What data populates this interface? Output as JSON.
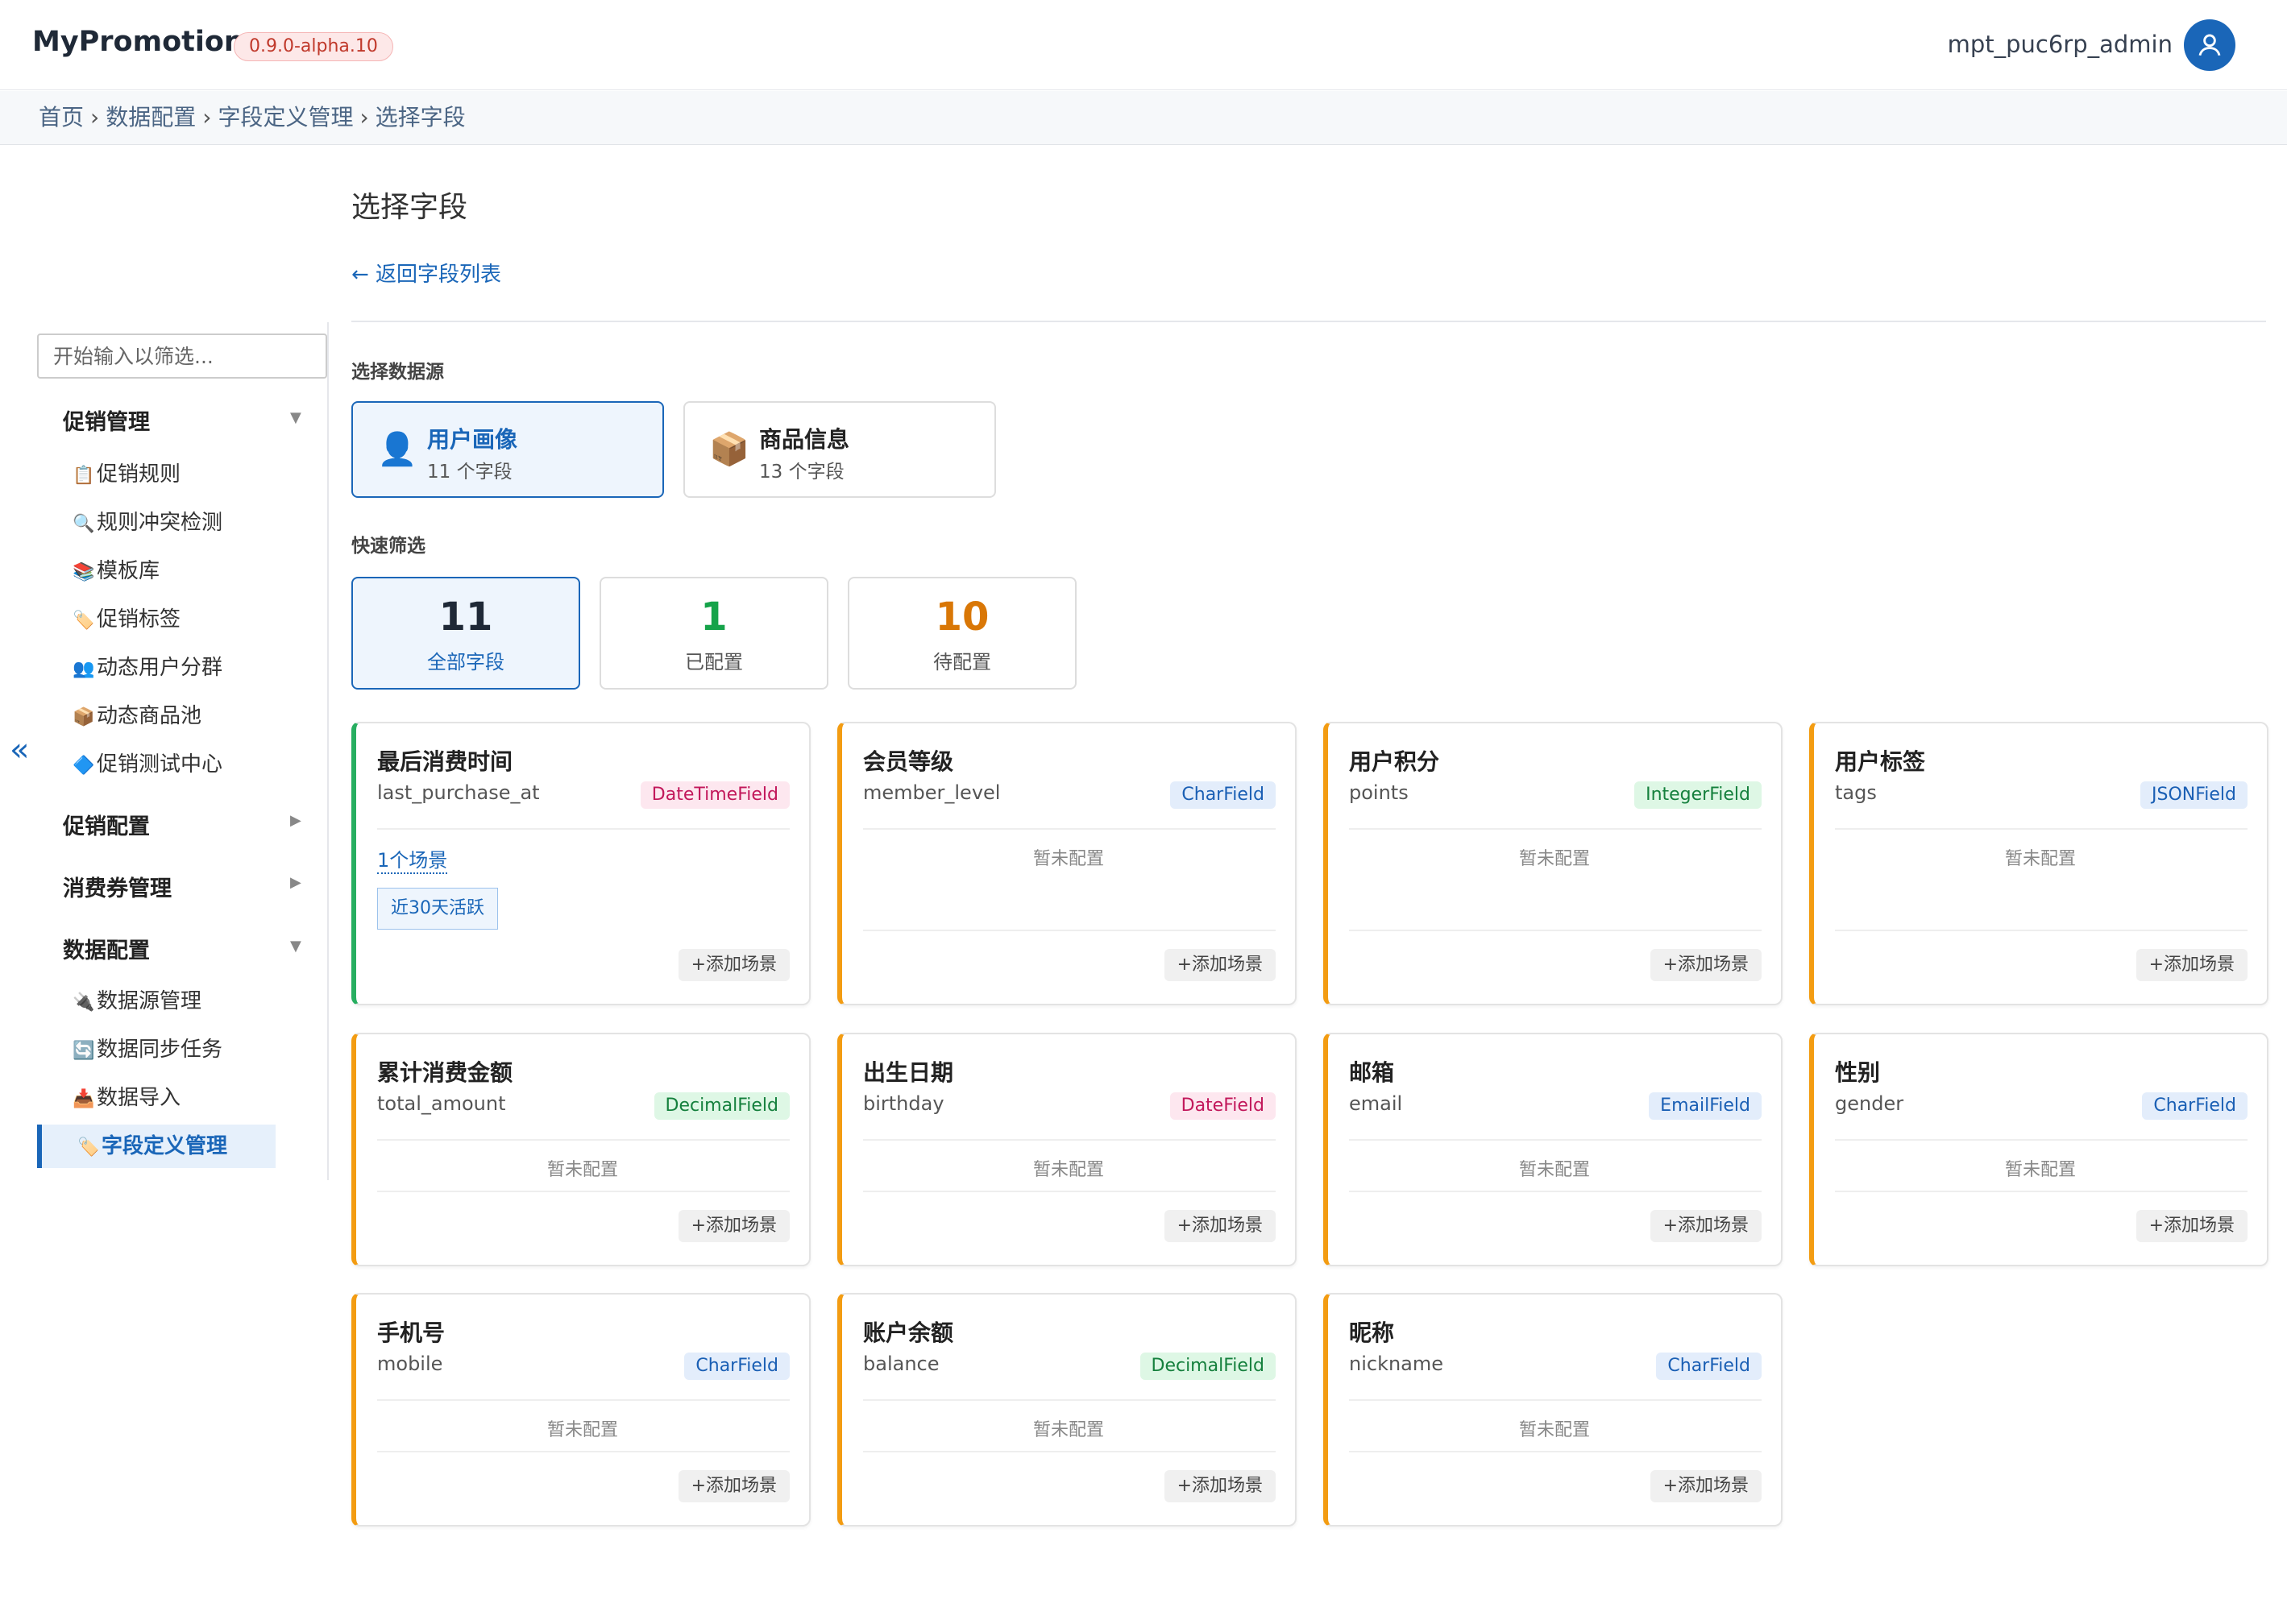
{
  "app": {
    "brand": "MyPromotion",
    "version": "0.9.0-alpha.10",
    "user": "mpt_puc6rp_admin"
  },
  "breadcrumb": [
    "首页",
    "数据配置",
    "字段定义管理",
    "选择字段"
  ],
  "sidebar": {
    "filter_placeholder": "开始输入以筛选...",
    "groups": [
      {
        "label": "促销管理",
        "caret": "▼",
        "items": [
          {
            "icon": "📋",
            "label": "促销规则"
          },
          {
            "icon": "🔍",
            "label": "规则冲突检测"
          },
          {
            "icon": "📚",
            "label": "模板库"
          },
          {
            "icon": "🏷️",
            "label": "促销标签"
          },
          {
            "icon": "👥",
            "label": "动态用户分群"
          },
          {
            "icon": "📦",
            "label": "动态商品池"
          },
          {
            "icon": "🔷",
            "label": "促销测试中心"
          }
        ]
      },
      {
        "label": "促销配置",
        "caret": "▶"
      },
      {
        "label": "消费券管理",
        "caret": "▶"
      },
      {
        "label": "数据配置",
        "caret": "▼",
        "items": [
          {
            "icon": "🔌",
            "label": "数据源管理"
          },
          {
            "icon": "🔄",
            "label": "数据同步任务"
          },
          {
            "icon": "📥",
            "label": "数据导入"
          },
          {
            "icon": "🏷️",
            "label": "字段定义管理"
          }
        ]
      }
    ],
    "collapse": "«"
  },
  "main": {
    "title": "选择字段",
    "back": "← 返回字段列表",
    "source_label": "选择数据源",
    "sources": [
      {
        "icon": "👤",
        "name": "用户画像",
        "count": "11 个字段"
      },
      {
        "icon": "📦",
        "name": "商品信息",
        "count": "13 个字段"
      }
    ],
    "filter_label": "快速筛选",
    "stats": [
      {
        "num": "11",
        "label": "全部字段",
        "color": "#1f2937"
      },
      {
        "num": "1",
        "label": "已配置",
        "color": "#16a34a"
      },
      {
        "num": "10",
        "label": "待配置",
        "color": "#d97706"
      }
    ],
    "not_configured": "暂未配置",
    "add_label": "+添加场景",
    "fields": [
      {
        "title": "最后消费时间",
        "key": "last_purchase_at",
        "type": "DateTimeField",
        "scenes": "1个场景",
        "tag": "近30天活跃"
      },
      {
        "title": "会员等级",
        "key": "member_level",
        "type": "CharField"
      },
      {
        "title": "用户积分",
        "key": "points",
        "type": "IntegerField"
      },
      {
        "title": "用户标签",
        "key": "tags",
        "type": "JSONField"
      },
      {
        "title": "累计消费金额",
        "key": "total_amount",
        "type": "DecimalField"
      },
      {
        "title": "出生日期",
        "key": "birthday",
        "type": "DateField"
      },
      {
        "title": "邮箱",
        "key": "email",
        "type": "EmailField"
      },
      {
        "title": "性别",
        "key": "gender",
        "type": "CharField"
      },
      {
        "title": "手机号",
        "key": "mobile",
        "type": "CharField"
      },
      {
        "title": "账户余额",
        "key": "balance",
        "type": "DecimalField"
      },
      {
        "title": "昵称",
        "key": "nickname",
        "type": "CharField"
      }
    ],
    "type_colors": {
      "DateTimeField": {
        "bg": "#fde7ef",
        "fg": "#c2185b"
      },
      "DateField": {
        "bg": "#fde7ef",
        "fg": "#c2185b"
      },
      "CharField": {
        "bg": "#e3edfb",
        "fg": "#1a5fb4"
      },
      "EmailField": {
        "bg": "#e3edfb",
        "fg": "#1a5fb4"
      },
      "JSONField": {
        "bg": "#e3edfb",
        "fg": "#1a5fb4"
      },
      "IntegerField": {
        "bg": "#def7e5",
        "fg": "#15803d"
      },
      "DecimalField": {
        "bg": "#def7e5",
        "fg": "#15803d"
      }
    }
  }
}
